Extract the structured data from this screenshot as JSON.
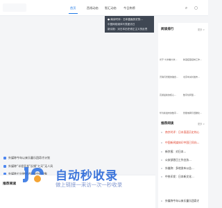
{
  "header": {
    "nav": [
      "首页",
      "西线动态",
      "智汇动态",
      "今日热榜"
    ],
    "search_icon": "search-icon",
    "user_icon": "user-icon"
  },
  "dropdown": {
    "items": [
      "● 南京时评：日本直面历史的...",
      "中国网络媒体代表团访日",
      "新京报：对日本历史修正主义的反思"
    ]
  },
  "main": {
    "items": [
      "外媒称今年以来乐童乐团奇才计划",
      "外媒称“半径开发”反馈“七天”无人风",
      "外媒称七分钟经济回旋中的现象"
    ],
    "section_title": "推荐阅读"
  },
  "sidebar": {
    "hot": {
      "title": "阅读排行",
      "more": "更多 >",
      "thumbs": [
        "光于“大米看大米…",
        "新冠疫苗接种工作…",
        "灵魂与智能的融合…",
        "北京中关村发布…",
        "高通最新的核心…",
        "数字化转型…",
        "华为新发布的数字…",
        "智能电网与低碳化…"
      ]
    },
    "recommend": {
      "title": "推荐阅读",
      "more": "更多 >",
      "items": [
        "南京时评：日本直面历史的心",
        "中国新闻媒体印中国已同向—",
        "新京报：对日本…",
        "公安部首日工作业务…",
        "外媒称：多地发布公告…",
        "中央印发：日本新文化…"
      ],
      "bottom_item": "外媒称今年以来乐童乐团奇才"
    }
  },
  "watermark": {
    "title": "自动秒收录",
    "subtitle": "做上链接一来访一次一秒收录"
  },
  "colors": {
    "accent": "#1e78e6",
    "dropdown_bg": "#3f4753",
    "hot": "#e0442f"
  }
}
